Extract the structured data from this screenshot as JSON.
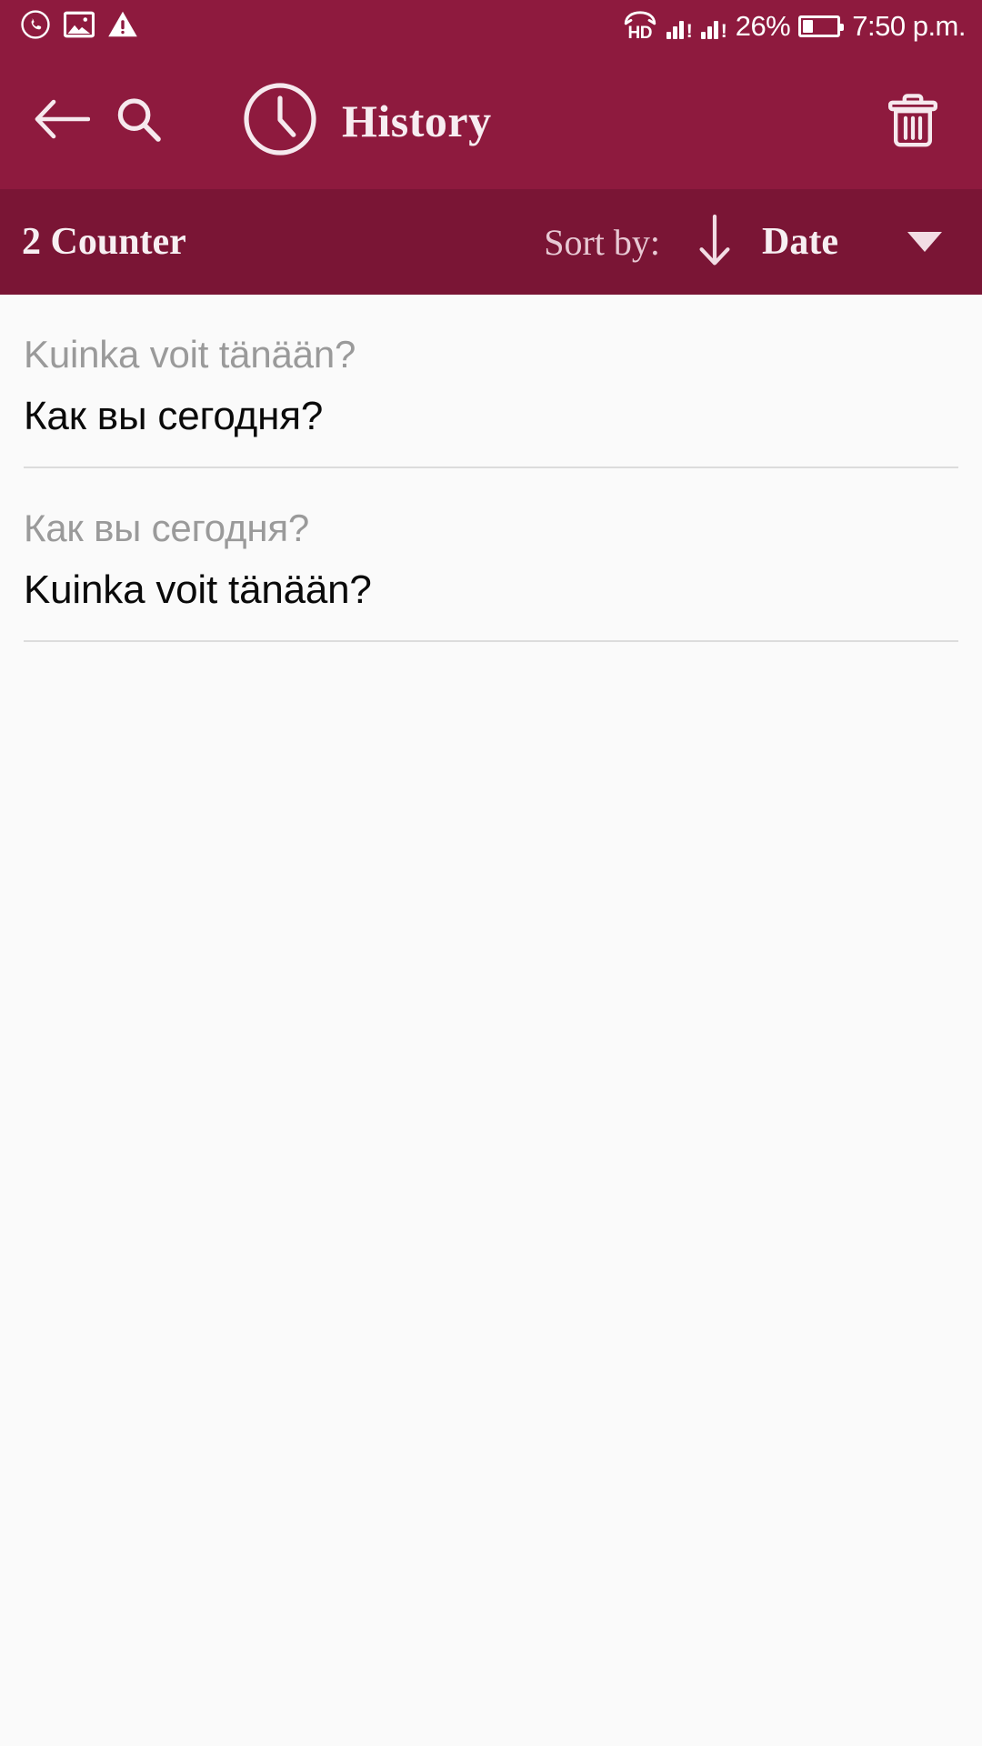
{
  "status_bar": {
    "left_icons": [
      "whatsapp-icon",
      "image-icon",
      "warning-icon"
    ],
    "volte_label": "HD",
    "signal_1": "signal-bars-icon",
    "signal_2": "signal-bars-icon",
    "signal_alert": "!",
    "battery_percent": "26%",
    "time": "7:50 p.m."
  },
  "app_bar": {
    "back_icon": "back-arrow-icon",
    "search_icon": "search-icon",
    "history_icon": "clock-icon",
    "title": "History",
    "delete_icon": "trash-icon"
  },
  "sort_bar": {
    "counter": "2 Counter",
    "sort_by_label": "Sort by:",
    "sort_direction_icon": "arrow-down-icon",
    "sort_value": "Date",
    "dropdown_icon": "caret-down-icon"
  },
  "history": {
    "items": [
      {
        "source_text": "Kuinka voit tänään?",
        "target_text": "Как вы сегодня?"
      },
      {
        "source_text": "Как вы сегодня?",
        "target_text": "Kuinka voit tänään?"
      }
    ]
  },
  "colors": {
    "app_bar": "#8E1A3E",
    "sort_bar": "#7A1535",
    "background": "#FAFAFA",
    "source_text": "#9A9A9A",
    "target_text": "#0A0A0A",
    "divider": "#DCDCDC",
    "on_primary": "#F6E9EE"
  }
}
